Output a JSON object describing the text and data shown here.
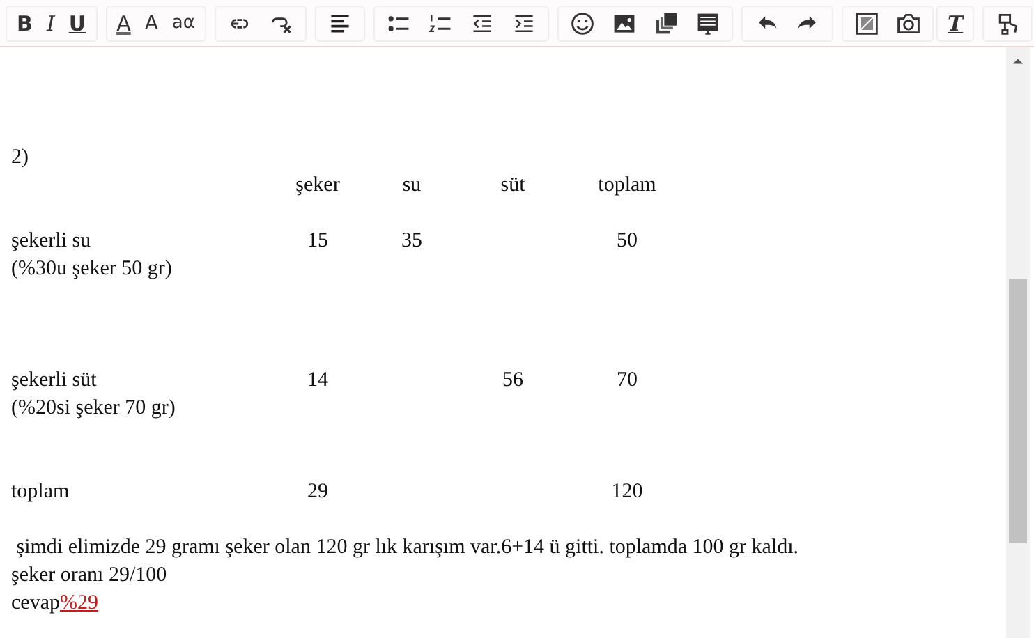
{
  "toolbar": {
    "groups": [
      [
        {
          "kind": "bold",
          "label": "B"
        },
        {
          "kind": "italic",
          "label": "I"
        },
        {
          "kind": "underline",
          "label": "U"
        }
      ],
      [
        {
          "kind": "font-color",
          "label": "A"
        },
        {
          "kind": "font-size",
          "label": "A"
        },
        {
          "kind": "font-case",
          "label": "aα"
        }
      ],
      [
        {
          "kind": "link"
        },
        {
          "kind": "unlink"
        }
      ],
      [
        {
          "kind": "align"
        }
      ],
      [
        {
          "kind": "bullets"
        },
        {
          "kind": "numbers"
        },
        {
          "kind": "outdent"
        },
        {
          "kind": "indent"
        }
      ],
      [
        {
          "kind": "emoji"
        },
        {
          "kind": "image"
        },
        {
          "kind": "gallery"
        },
        {
          "kind": "document"
        }
      ],
      [
        {
          "kind": "undo"
        },
        {
          "kind": "redo"
        }
      ],
      [
        {
          "kind": "picture"
        },
        {
          "kind": "camera"
        }
      ]
    ],
    "right": [
      {
        "kind": "clear-format",
        "label": "T"
      },
      {
        "kind": "format-painter"
      }
    ]
  },
  "content": {
    "heading": "2)",
    "table": {
      "columns": [
        "şeker",
        "su",
        "süt",
        "toplam"
      ],
      "rows": [
        {
          "label": "şekerli su",
          "note": "(%30u şeker 50 gr)",
          "cells": [
            "15",
            "35",
            null,
            "50"
          ]
        },
        {
          "label": "şekerli süt",
          "note": "(%20si şeker 70 gr)",
          "cells": [
            "14",
            null,
            "56",
            "70"
          ]
        },
        {
          "label": "toplam",
          "cells": [
            "29",
            null,
            null,
            "120"
          ]
        }
      ]
    },
    "lines": [
      " şimdi elimizde 29 gramı şeker olan 120 gr lık karışım var.6+14 ü gitti. toplamda 100 gr kaldı.",
      "şeker oranı 29/100"
    ],
    "answer": {
      "label": "cevap",
      "value": "%29"
    }
  }
}
